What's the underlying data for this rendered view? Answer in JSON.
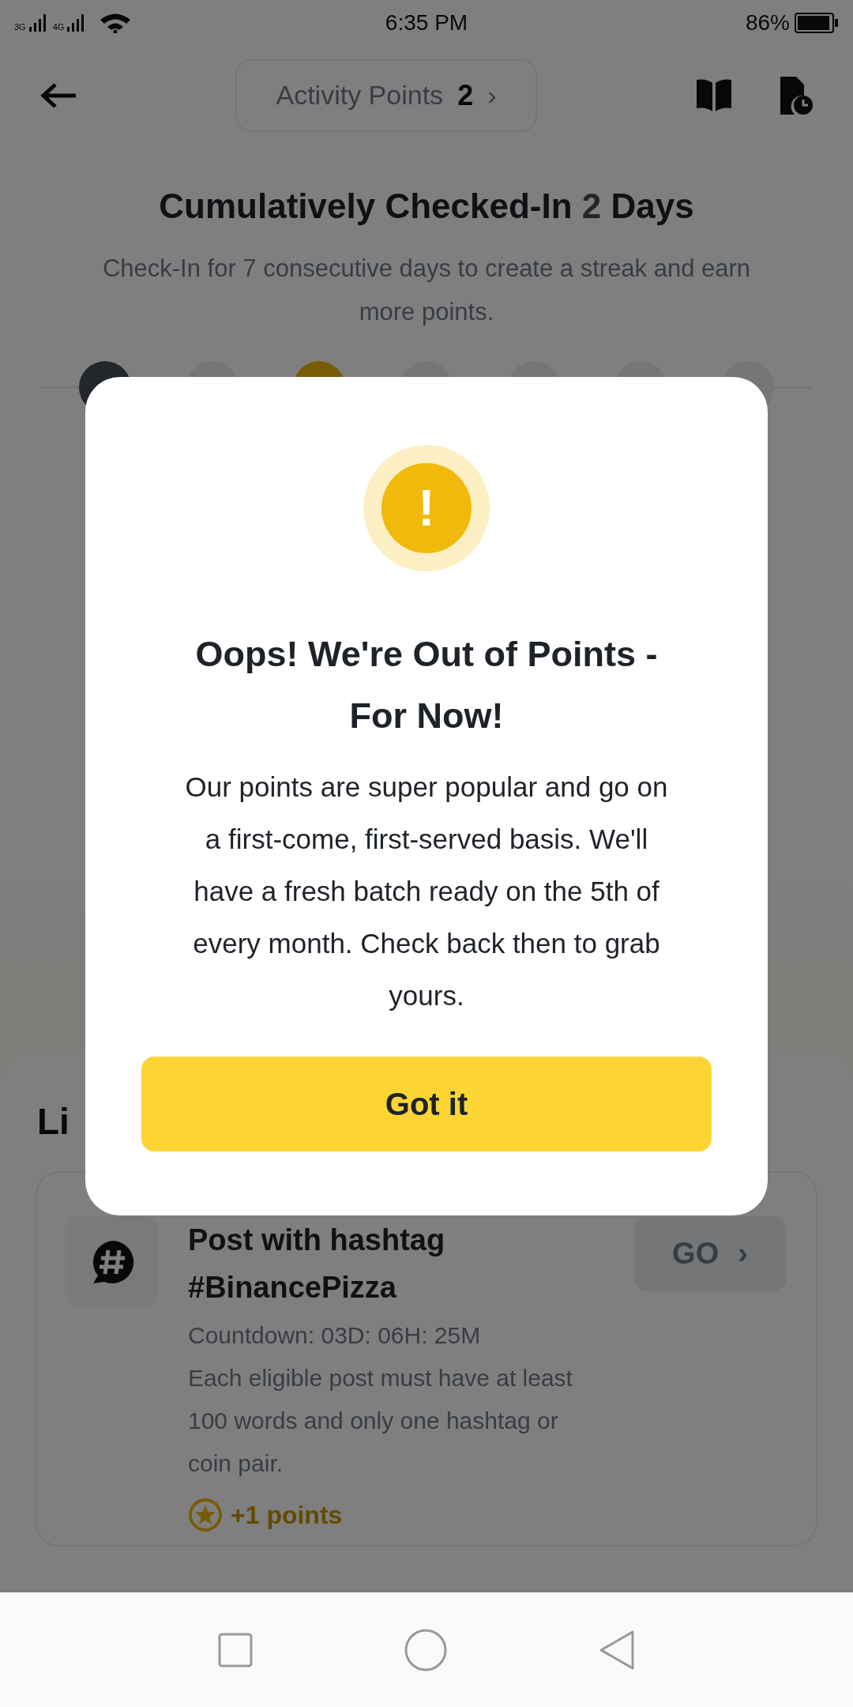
{
  "status_bar": {
    "network_1": "3G",
    "network_2": "4G",
    "time": "6:35 PM",
    "battery": "86%"
  },
  "header": {
    "points_label": "Activity Points",
    "points_value": "2",
    "chevron": "›"
  },
  "checkin": {
    "title_before": "Cumulatively Checked-In ",
    "title_count": "2",
    "title_after": " Days",
    "subtitle": "Check-In for 7 consecutive days to create a streak and earn more points.",
    "days": [
      {
        "checked": true,
        "today": false
      },
      {
        "checked": false,
        "today": false
      },
      {
        "checked": false,
        "today": true
      },
      {
        "checked": false,
        "today": false
      },
      {
        "checked": false,
        "today": false
      },
      {
        "checked": false,
        "today": false
      },
      {
        "checked": false,
        "today": false
      }
    ]
  },
  "section_title": "Li",
  "task": {
    "title": "Post with hashtag #BinancePizza",
    "countdown": "Countdown: 03D: 06H: 25M",
    "description": "Each eligible post must have at least 100 words and only one hashtag or coin pair.",
    "reward": "+1 points",
    "button": "GO",
    "button_chevron": "›",
    "disabled": true
  },
  "dialog": {
    "icon": "!",
    "title": "Oops! We're Out of Points - For Now!",
    "message": "Our points are super popular and go on a first-come, first-served basis. We'll have a fresh batch ready on the 5th of every month. Check back then to grab yours.",
    "button": "Got it"
  }
}
